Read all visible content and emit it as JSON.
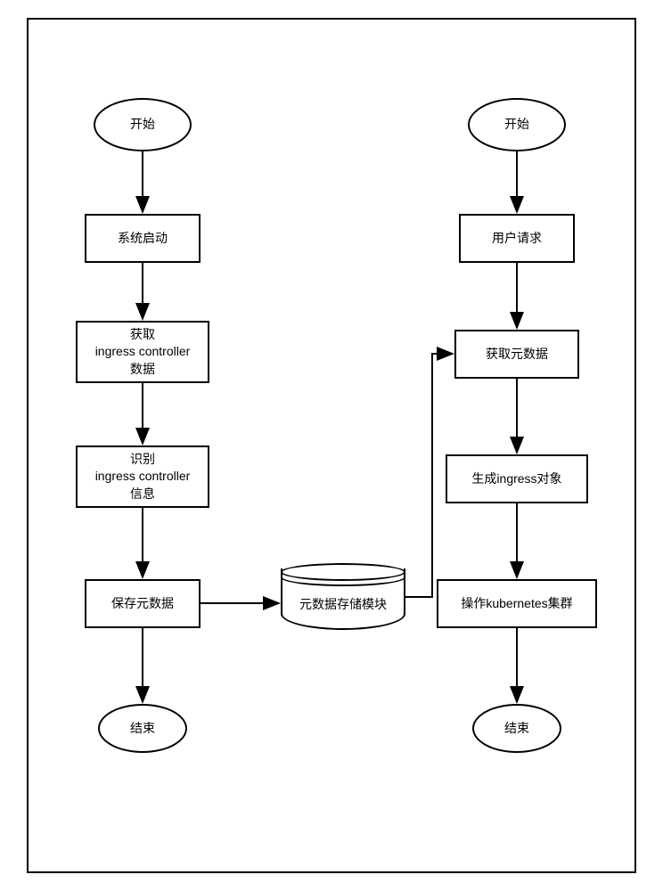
{
  "flow_left": {
    "start": "开始",
    "step1": "系统启动",
    "step2_line1": "获取",
    "step2_line2": "ingress controller",
    "step2_line3": "数据",
    "step3_line1": "识别",
    "step3_line2": "ingress controller",
    "step3_line3": "信息",
    "step4": "保存元数据",
    "end": "结束"
  },
  "center": {
    "store": "元数据存储模块"
  },
  "flow_right": {
    "start": "开始",
    "step1": "用户请求",
    "step2": "获取元数据",
    "step3": "生成ingress对象",
    "step4": "操作kubernetes集群",
    "end": "结束"
  }
}
